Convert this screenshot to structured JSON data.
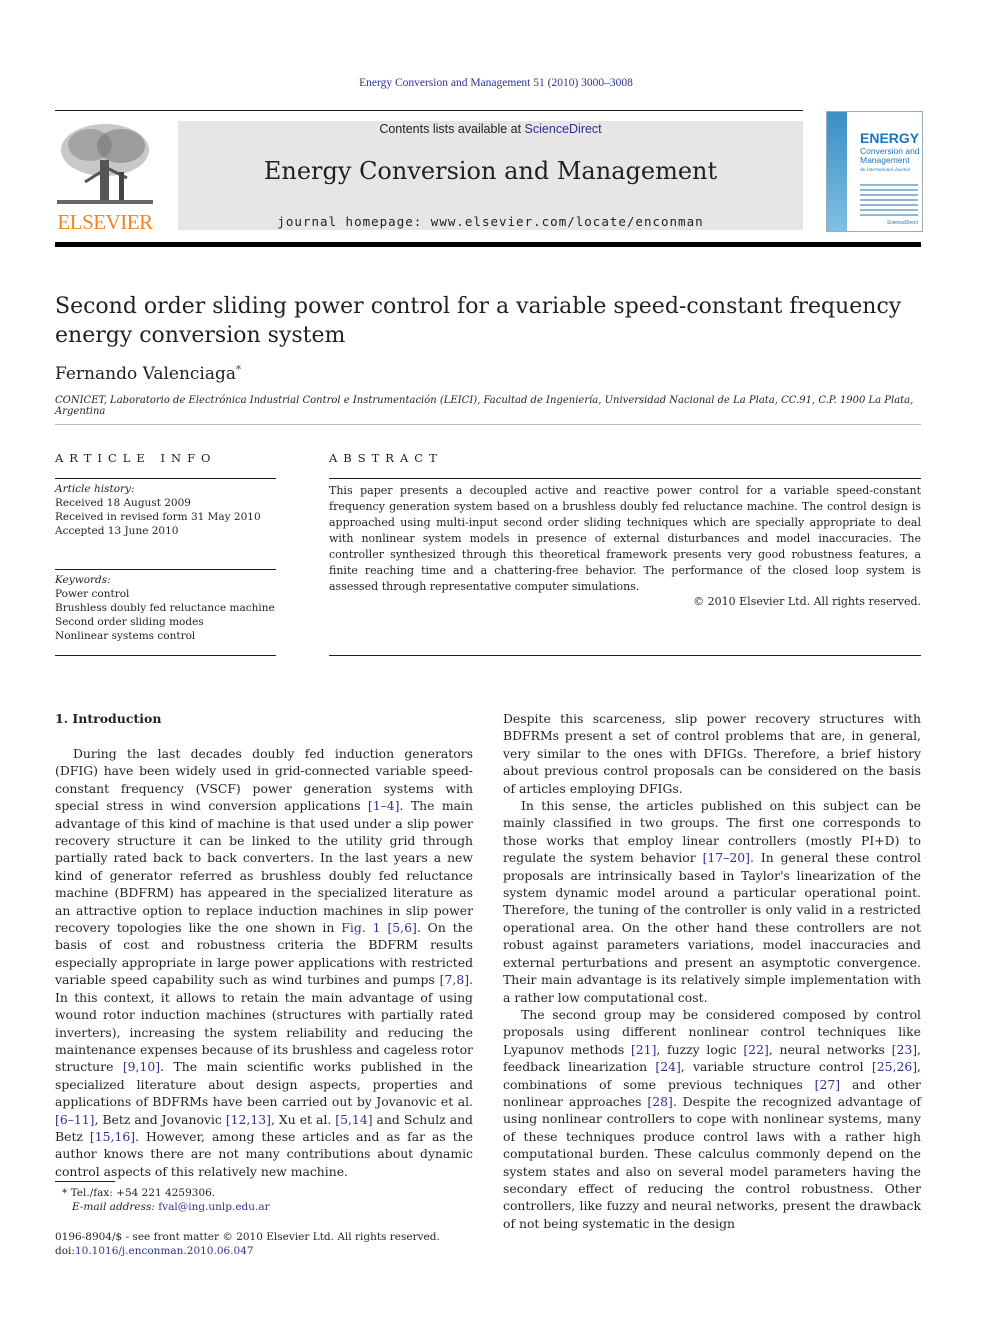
{
  "header": {
    "citation": "Energy Conversion and Management 51 (2010) 3000–3008",
    "publisher_logo_text": "ELSEVIER",
    "contents_prefix": "Contents lists available at ",
    "contents_link": "ScienceDirect",
    "journal_name": "Energy Conversion and Management",
    "homepage": "journal homepage: www.elsevier.com/locate/enconman",
    "cover": {
      "title_line1": "ENERGY",
      "title_line2": "Conversion and",
      "title_line3": "Management",
      "subtitle": "An International Journal",
      "footer": "ScienceDirect"
    }
  },
  "article": {
    "title": "Second order sliding power control for a variable speed-constant frequency energy conversion system",
    "author": "Fernando Valenciaga",
    "author_mark": "*",
    "affiliation": "CONICET, Laboratorio de Electrónica Industrial Control e Instrumentación (LEICI), Facultad de Ingeniería, Universidad Nacional de La Plata, CC.91, C.P. 1900 La Plata, Argentina"
  },
  "article_info": {
    "label": "ARTICLE INFO",
    "history_label": "Article history:",
    "history": [
      "Received 18 August 2009",
      "Received in revised form 31 May 2010",
      "Accepted 13 June 2010"
    ],
    "keywords_label": "Keywords:",
    "keywords": [
      "Power control",
      "Brushless doubly fed reluctance machine",
      "Second order sliding modes",
      "Nonlinear systems control"
    ]
  },
  "abstract": {
    "label": "ABSTRACT",
    "text": "This paper presents a decoupled active and reactive power control for a variable speed-constant frequency generation system based on a brushless doubly fed reluctance machine. The control design is approached using multi-input second order sliding techniques which are specially appropriate to deal with nonlinear system models in presence of external disturbances and model inaccuracies. The controller synthesized through this theoretical framework presents very good robustness features, a finite reaching time and a chattering-free behavior. The performance of the closed loop system is assessed through representative computer simulations.",
    "copyright": "© 2010 Elsevier Ltd. All rights reserved."
  },
  "body": {
    "intro_heading": "1. Introduction",
    "left_col": {
      "p1_a": "During the last decades doubly fed induction generators (DFIG) have been widely used in grid-connected variable speed-constant frequency (VSCF) power generation systems with special stress in wind conversion applications ",
      "ref_1_4": "[1–4]",
      "p1_b": ". The main advantage of this kind of machine is that used under a slip power recovery structure it can be linked to the utility grid through partially rated back to back converters. In the last years a new kind of generator referred as brushless doubly fed reluctance machine (BDFRM) has appeared in the specialized literature as an attractive option to replace induction machines in slip power recovery topologies like the one shown in ",
      "fig1": "Fig. 1",
      "ref_5_6": "[5,6]",
      "p1_c": ". On the basis of cost and robustness criteria the BDFRM results especially appropriate in large power applications with restricted variable speed capability such as wind turbines and pumps ",
      "ref_7_8": "[7,8]",
      "p1_d": ". In this context, it allows to retain the main advantage of using wound rotor induction machines (structures with partially rated inverters), increasing the system reliability and reducing the maintenance expenses because of its brushless and cageless rotor structure ",
      "ref_9_10": "[9,10]",
      "p1_e": ". The main scientific works published in the specialized literature about design aspects, properties and applications of BDFRMs have been carried out by Jovanovic et al. ",
      "ref_6_11": "[6–11]",
      "p1_f": ", Betz and Jovanovic ",
      "ref_12_13": "[12,13]",
      "p1_g": ", Xu et al. ",
      "ref_5_14": "[5,14]",
      "p1_h": " and Schulz and Betz ",
      "ref_15_16": "[15,16]",
      "p1_i": ". However, among these articles and as far as the author knows there are not many contributions about dynamic control aspects of this relatively new machine."
    },
    "right_col": {
      "p1": "Despite this scarceness, slip power recovery structures with BDFRMs present a set of control problems that are, in general, very similar to the ones with DFIGs. Therefore, a brief history about previous control proposals can be considered on the basis of articles employing DFIGs.",
      "p2_a": "In this sense, the articles published on this subject can be mainly classified in two groups. The first one corresponds to those works that employ linear controllers (mostly PI+D) to regulate the system behavior ",
      "ref_17_20": "[17–20]",
      "p2_b": ". In general these control proposals are intrinsically based in Taylor's linearization of the system dynamic model around a particular operational point. Therefore, the tuning of the controller is only valid in a restricted operational area. On the other hand these controllers are not robust against parameters variations, model inaccuracies and external perturbations and present an asymptotic convergence. Their main advantage is its relatively simple implementation with a rather low computational cost.",
      "p3_a": "The second group may be considered composed by control proposals using different nonlinear control techniques like Lyapunov methods ",
      "ref_21": "[21]",
      "p3_b": ", fuzzy logic ",
      "ref_22": "[22]",
      "p3_c": ", neural networks ",
      "ref_23": "[23]",
      "p3_d": ", feedback linearization ",
      "ref_24": "[24]",
      "p3_e": ", variable structure control ",
      "ref_25_26": "[25,26]",
      "p3_f": ", combinations of some previous techniques ",
      "ref_27": "[27]",
      "p3_g": " and other nonlinear approaches ",
      "ref_28": "[28]",
      "p3_h": ". Despite the recognized advantage of using nonlinear controllers to cope with nonlinear systems, many of these techniques produce control laws with a rather high computational burden. These calculus commonly depend on the system states and also on several model parameters having the secondary effect of reducing the control robustness. Other controllers, like fuzzy and neural networks, present the drawback of not being systematic in the design"
    }
  },
  "footnote": {
    "mark": "*",
    "tel": "Tel./fax: +54 221 4259306.",
    "email_label": "E-mail address: ",
    "email": "fval@ing.unlp.edu.ar"
  },
  "front_matter": {
    "issn_line": "0196-8904/$ - see front matter © 2010 Elsevier Ltd. All rights reserved.",
    "doi_prefix": "doi:",
    "doi": "10.1016/j.enconman.2010.06.047"
  },
  "colors": {
    "link": "#2e3192",
    "elsevier_orange": "#f58220",
    "masthead_bg": "#e6e6e6"
  }
}
